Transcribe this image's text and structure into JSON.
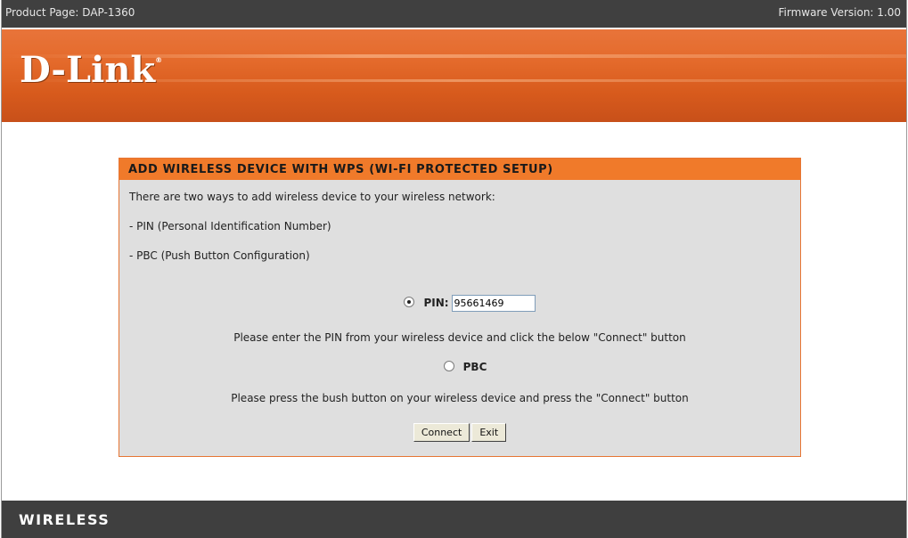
{
  "header": {
    "product_page": "Product Page: DAP-1360",
    "firmware": "Firmware Version: 1.00",
    "logo": "D-Link",
    "logo_mark": "®"
  },
  "panel": {
    "title": "ADD WIRELESS DEVICE WITH WPS (WI-FI PROTECTED SETUP)",
    "intro": "There are two ways to add wireless device to your wireless network:",
    "method_pin": "- PIN (Personal Identification Number)",
    "method_pbc": "- PBC (Push Button Configuration)",
    "pin_option": {
      "label": "PIN:",
      "selected": true,
      "value": "95661469"
    },
    "pin_instruction": "Please enter the PIN from your wireless device and click the below \"Connect\" button",
    "pbc_option": {
      "label": "PBC",
      "selected": false
    },
    "pbc_instruction": "Please press the bush button on your wireless device and press the \"Connect\" button",
    "buttons": {
      "connect": "Connect",
      "exit": "Exit"
    }
  },
  "footer": {
    "label": "WIRELESS"
  },
  "colors": {
    "accent": "#f07a2a",
    "panel_bg": "#dfdfdf",
    "bar_bg": "#404040"
  }
}
